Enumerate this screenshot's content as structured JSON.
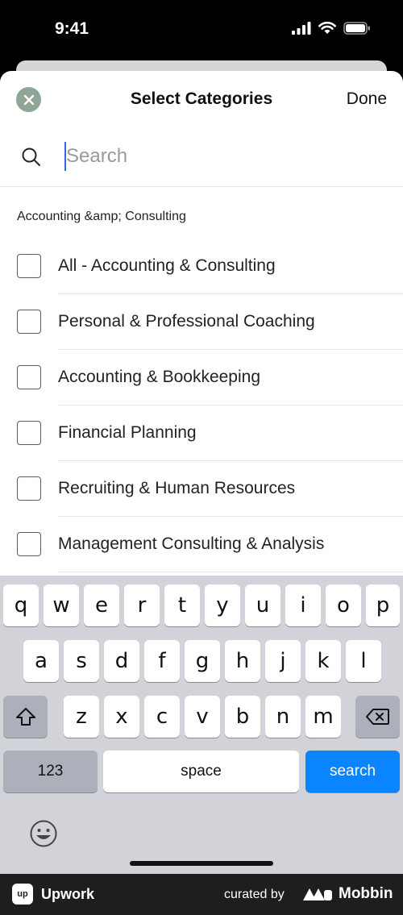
{
  "status_bar": {
    "time": "9:41"
  },
  "header": {
    "title": "Select Categories",
    "done_label": "Done"
  },
  "search": {
    "placeholder": "Search",
    "value": ""
  },
  "section": {
    "title": "Accounting &amp; Consulting"
  },
  "categories": [
    {
      "label": "All - Accounting & Consulting",
      "checked": false
    },
    {
      "label": "Personal & Professional Coaching",
      "checked": false
    },
    {
      "label": "Accounting & Bookkeeping",
      "checked": false
    },
    {
      "label": "Financial Planning",
      "checked": false
    },
    {
      "label": "Recruiting & Human Resources",
      "checked": false
    },
    {
      "label": "Management Consulting & Analysis",
      "checked": false
    }
  ],
  "keyboard": {
    "row1": [
      "q",
      "w",
      "e",
      "r",
      "t",
      "y",
      "u",
      "i",
      "o",
      "p"
    ],
    "row2": [
      "a",
      "s",
      "d",
      "f",
      "g",
      "h",
      "j",
      "k",
      "l"
    ],
    "row3": [
      "z",
      "x",
      "c",
      "v",
      "b",
      "n",
      "m"
    ],
    "numbers_label": "123",
    "space_label": "space",
    "search_label": "search"
  },
  "footer": {
    "app_name": "Upwork",
    "logo_text": "up",
    "curated_by": "curated by",
    "brand": "Mobbin"
  },
  "colors": {
    "accent": "#0a84ff",
    "close_button": "#8fa595",
    "cursor": "#3366e6"
  }
}
